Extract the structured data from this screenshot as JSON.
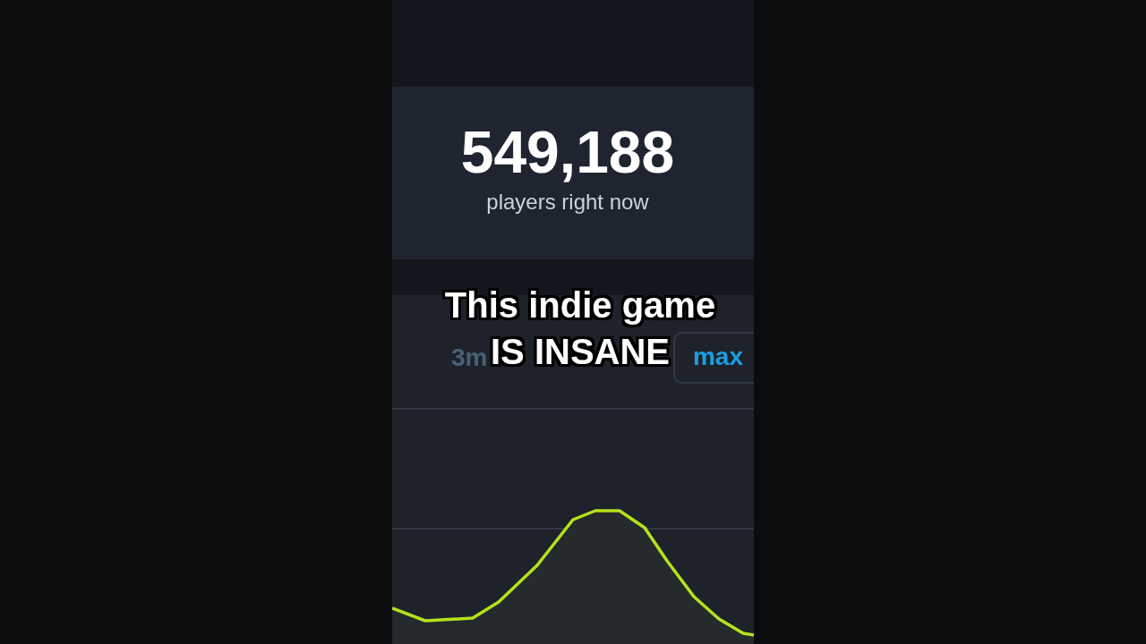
{
  "stats": {
    "value": "549,188",
    "label": "players right now"
  },
  "range_tabs": [
    {
      "label": "3m",
      "selected": false
    },
    {
      "label": "max",
      "selected": true
    }
  ],
  "caption": [
    "This indie game",
    "IS INSANE"
  ]
}
